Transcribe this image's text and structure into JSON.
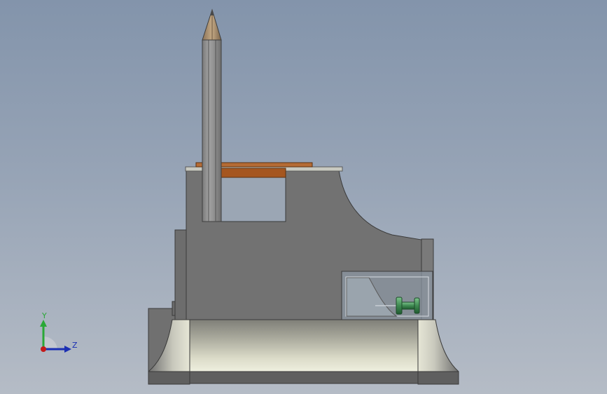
{
  "viewport": {
    "background_top": "#8394ab",
    "background_bottom": "#b5bcc6"
  },
  "model": {
    "description_icon": "cad-assembly-side-view",
    "colors": {
      "body": "#727272",
      "body_edge": "#3a3a3a",
      "body_light": "#8c8c8c",
      "pencil_body": "#8e8e8e",
      "pencil_tip_wood": "#b4997a",
      "pencil_lead": "#4a4a4a",
      "bar_top": "#b56b34",
      "bar_main": "#a5561f",
      "base_light": "#e8e9d6",
      "base_dark": "#5f5f5f",
      "glass": "#8f9aa6",
      "spool_green": "#3f8a52"
    }
  },
  "triad": {
    "y_label": "Y",
    "z_label": "Z",
    "y_color": "#2aa837",
    "z_color": "#1b2fb3",
    "x_color": "#c41a1a"
  }
}
